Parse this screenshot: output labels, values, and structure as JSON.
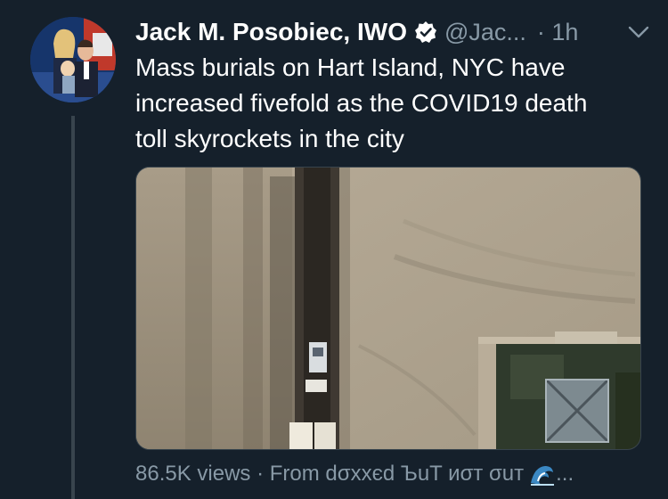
{
  "tweet": {
    "author_name": "Jack M. Posobiec, IWO",
    "handle": "@Jac...",
    "time": "· 1h",
    "text": "Mass burials on Hart Island, NYC have\nincreased fivefold as the COVID19 death\ntoll skyrockets in the city",
    "views": "86.5K views",
    "source_prefix": " · From ",
    "source_name": "dσxxєd ЪuT иσт σuт",
    "source_ellipsis": "..."
  },
  "icons": {
    "verified": "verified-badge-icon",
    "chevron": "chevron-down-icon",
    "wave": "wave-emoji-icon"
  },
  "colors": {
    "background": "#15202b",
    "secondary_text": "#8899a6",
    "border": "#38444d"
  }
}
